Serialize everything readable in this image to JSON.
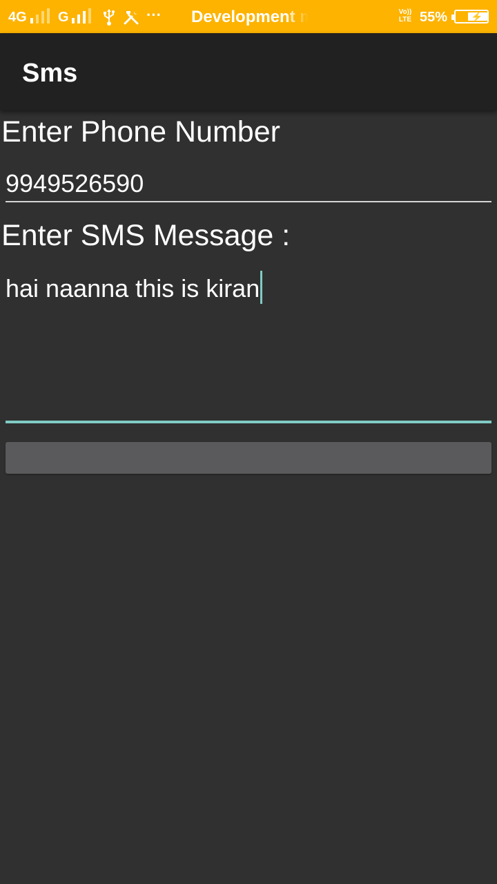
{
  "status_bar": {
    "network_1": "4G",
    "network_2": "G",
    "more_indicator": "···",
    "notification_title": "Development mode",
    "volte_top": "Vo))",
    "volte_bottom": "LTE",
    "battery_percent": "55%",
    "battery_level": 0.55,
    "icons": [
      "signal-icon",
      "usb-icon",
      "tools-icon",
      "volte-icon",
      "battery-icon",
      "charging-bolt-icon"
    ],
    "colors": {
      "background": "#fdb300",
      "foreground": "#ffffff"
    }
  },
  "app_bar": {
    "title": "Sms",
    "background": "#212121"
  },
  "form": {
    "phone_label": "Enter Phone Number",
    "phone_value": "9949526590",
    "message_label": "Enter SMS Message :",
    "message_value": "hai naanna this is kiran",
    "send_button_label": ""
  },
  "colors": {
    "page_background": "#303030",
    "accent": "#80cbc4",
    "button_background": "#5a5a5c"
  }
}
